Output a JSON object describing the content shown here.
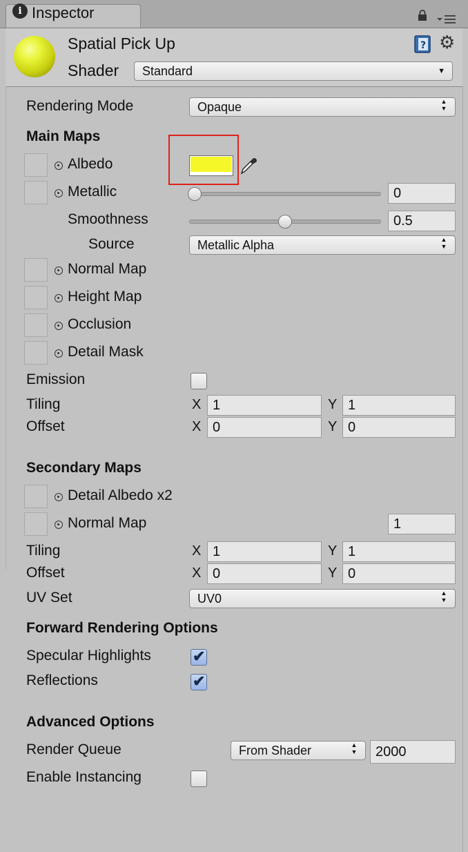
{
  "window": {
    "tab_icon": "info-icon",
    "tab_icon_glyph": "i",
    "tab_label": "Inspector"
  },
  "header": {
    "material_name": "Spatial Pick Up",
    "shader_label": "Shader",
    "shader_value": "Standard"
  },
  "rendering_mode": {
    "label": "Rendering Mode",
    "value": "Opaque"
  },
  "main_maps": {
    "title": "Main Maps",
    "albedo": {
      "label": "Albedo",
      "color": "#f5f729"
    },
    "metallic": {
      "label": "Metallic",
      "value": "0",
      "slider_fraction": 0.0
    },
    "smoothness": {
      "label": "Smoothness",
      "value": "0.5",
      "slider_fraction": 0.5
    },
    "source": {
      "label": "Source",
      "value": "Metallic Alpha"
    },
    "normal_map": {
      "label": "Normal Map"
    },
    "height_map": {
      "label": "Height Map"
    },
    "occlusion": {
      "label": "Occlusion"
    },
    "detail_mask": {
      "label": "Detail Mask"
    },
    "emission": {
      "label": "Emission",
      "checked": false
    },
    "tiling": {
      "label": "Tiling",
      "x_label": "X",
      "x": "1",
      "y_label": "Y",
      "y": "1"
    },
    "offset": {
      "label": "Offset",
      "x_label": "X",
      "x": "0",
      "y_label": "Y",
      "y": "0"
    }
  },
  "secondary_maps": {
    "title": "Secondary Maps",
    "detail_albedo": {
      "label": "Detail Albedo x2"
    },
    "normal_map": {
      "label": "Normal Map",
      "value": "1"
    },
    "tiling": {
      "label": "Tiling",
      "x_label": "X",
      "x": "1",
      "y_label": "Y",
      "y": "1"
    },
    "offset": {
      "label": "Offset",
      "x_label": "X",
      "x": "0",
      "y_label": "Y",
      "y": "0"
    },
    "uv_set": {
      "label": "UV Set",
      "value": "UV0"
    }
  },
  "forward_rendering": {
    "title": "Forward Rendering Options",
    "specular_highlights": {
      "label": "Specular Highlights",
      "checked": true
    },
    "reflections": {
      "label": "Reflections",
      "checked": true
    }
  },
  "advanced": {
    "title": "Advanced Options",
    "render_queue": {
      "label": "Render Queue",
      "dropdown": "From Shader",
      "value": "2000"
    },
    "enable_instancing": {
      "label": "Enable Instancing",
      "checked": false
    }
  },
  "glyphs": {
    "dropdown_arrow": "▼",
    "dropdown_updown": "▲▼",
    "check": "✔",
    "gear": "⚙"
  }
}
